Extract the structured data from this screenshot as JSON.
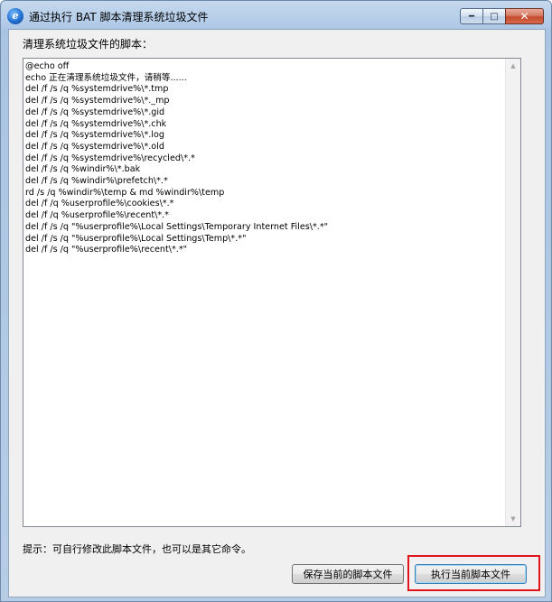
{
  "window": {
    "title": "通过执行 BAT 脚本清理系统垃圾文件",
    "icon": "app-logo-icon",
    "controls": {
      "minimize": "minimize-icon",
      "maximize": "maximize-icon",
      "close": "close-icon"
    }
  },
  "main": {
    "section_label": "清理系统垃圾文件的脚本：",
    "script_content": "@echo off\necho 正在清理系统垃圾文件，请稍等......\ndel /f /s /q %systemdrive%\\*.tmp\ndel /f /s /q %systemdrive%\\*._mp\ndel /f /s /q %systemdrive%\\*.gid\ndel /f /s /q %systemdrive%\\*.chk\ndel /f /s /q %systemdrive%\\*.log\ndel /f /s /q %systemdrive%\\*.old\ndel /f /s /q %systemdrive%\\recycled\\*.*\ndel /f /s /q %windir%\\*.bak\ndel /f /s /q %windir%\\prefetch\\*.*\nrd /s /q %windir%\\temp & md %windir%\\temp\ndel /f /q %userprofile%\\cookies\\*.*\ndel /f /q %userprofile%\\recent\\*.*\ndel /f /s /q \"%userprofile%\\Local Settings\\Temporary Internet Files\\*.*\"\ndel /f /s /q \"%userprofile%\\Local Settings\\Temp\\*.*\"\ndel /f /s /q \"%userprofile%\\recent\\*.*\"",
    "hint": "提示：可自行修改此脚本文件，也可以是其它命令。"
  },
  "buttons": {
    "save_label": "保存当前的脚本文件",
    "run_label": "执行当前脚本文件"
  },
  "colors": {
    "highlight": "#e2141b",
    "titlebar": "#aec8e6"
  }
}
